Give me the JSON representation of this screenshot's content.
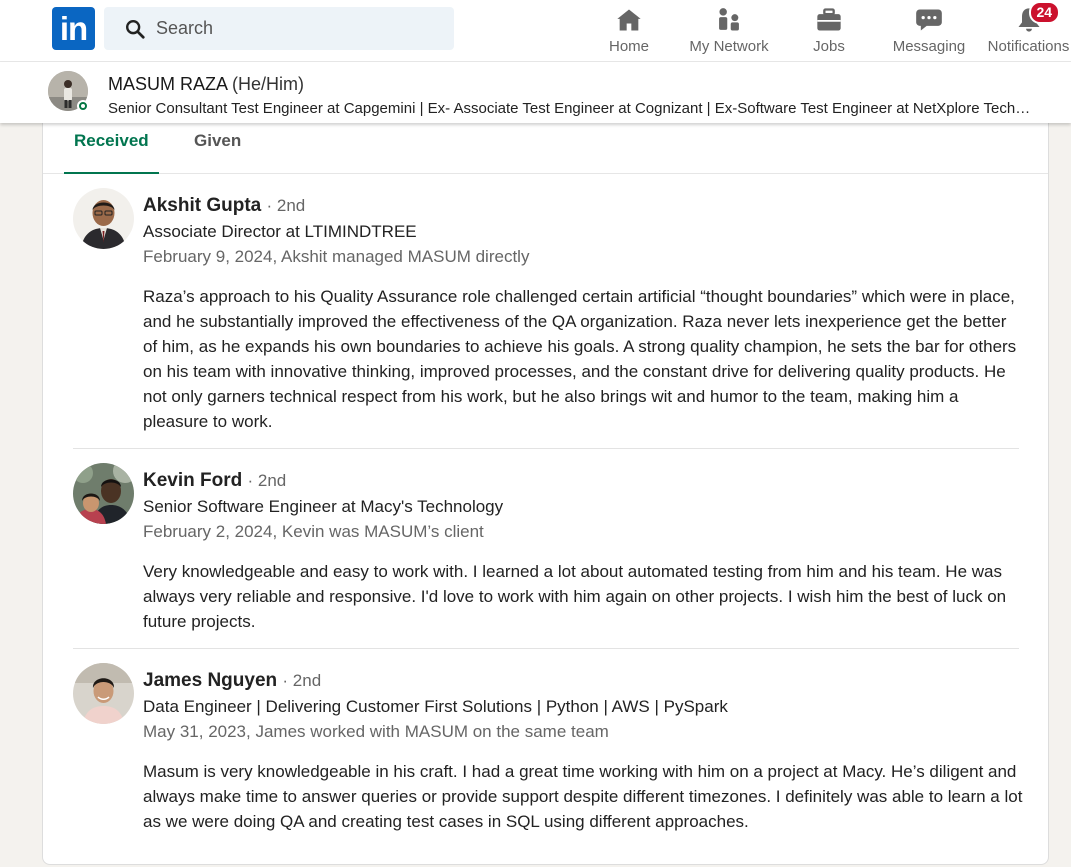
{
  "nav": {
    "logo_text": "in",
    "search_placeholder": "Search",
    "items": [
      {
        "label": "Home",
        "icon": "home-icon"
      },
      {
        "label": "My Network",
        "icon": "my-network-icon"
      },
      {
        "label": "Jobs",
        "icon": "jobs-icon"
      },
      {
        "label": "Messaging",
        "icon": "messaging-icon"
      },
      {
        "label": "Notifications",
        "icon": "notifications-icon",
        "badge": "24"
      }
    ],
    "colors": {
      "brand": "#0a66c2",
      "badge": "#cb112d"
    }
  },
  "profile": {
    "name": "MASUM RAZA",
    "pronouns": "(He/Him)",
    "headline": "Senior Consultant Test Engineer at Capgemini | Ex- Associate Test Engineer at Cognizant | Ex-Software Test Engineer at NetXplore Technologies"
  },
  "tabs": [
    {
      "label": "Received",
      "active": true
    },
    {
      "label": "Given",
      "active": false
    }
  ],
  "accent": "#01754f",
  "recommendations": [
    {
      "name": "Akshit Gupta",
      "degree": "· 2nd",
      "title": "Associate Director at LTIMINDTREE",
      "meta": "February 9, 2024, Akshit managed MASUM directly",
      "body": "Raza’s approach to his Quality Assurance role challenged certain artificial “thought boundaries” which were in place, and he substantially improved the effectiveness of the QA organization. Raza never lets inexperience get the better of him, as he expands his own boundaries to achieve his goals. A strong quality champion, he sets the bar for others on his team with innovative thinking, improved processes, and the constant drive for delivering quality products. He not only garners technical respect from his work, but he also brings wit and humor to the team, making him a pleasure to work."
    },
    {
      "name": "Kevin Ford",
      "degree": "· 2nd",
      "title": "Senior Software Engineer at Macy's Technology",
      "meta": "February 2, 2024, Kevin was MASUM’s client",
      "body": "Very knowledgeable and easy to work with. I learned a lot about automated testing from him and his team. He was always very reliable and responsive. I'd love to work with him again on other projects. I wish him the best of luck on future projects."
    },
    {
      "name": "James Nguyen",
      "degree": "· 2nd",
      "title": "Data Engineer | Delivering Customer First Solutions | Python | AWS | PySpark",
      "meta": "May 31, 2023, James worked with MASUM on the same team",
      "body": "Masum is very knowledgeable in his craft. I had a great time working with him on a project at Macy. He’s diligent and always make time to answer queries or provide support despite different timezones. I definitely was able to learn a lot as we were doing QA and creating test cases in SQL using different approaches."
    }
  ]
}
